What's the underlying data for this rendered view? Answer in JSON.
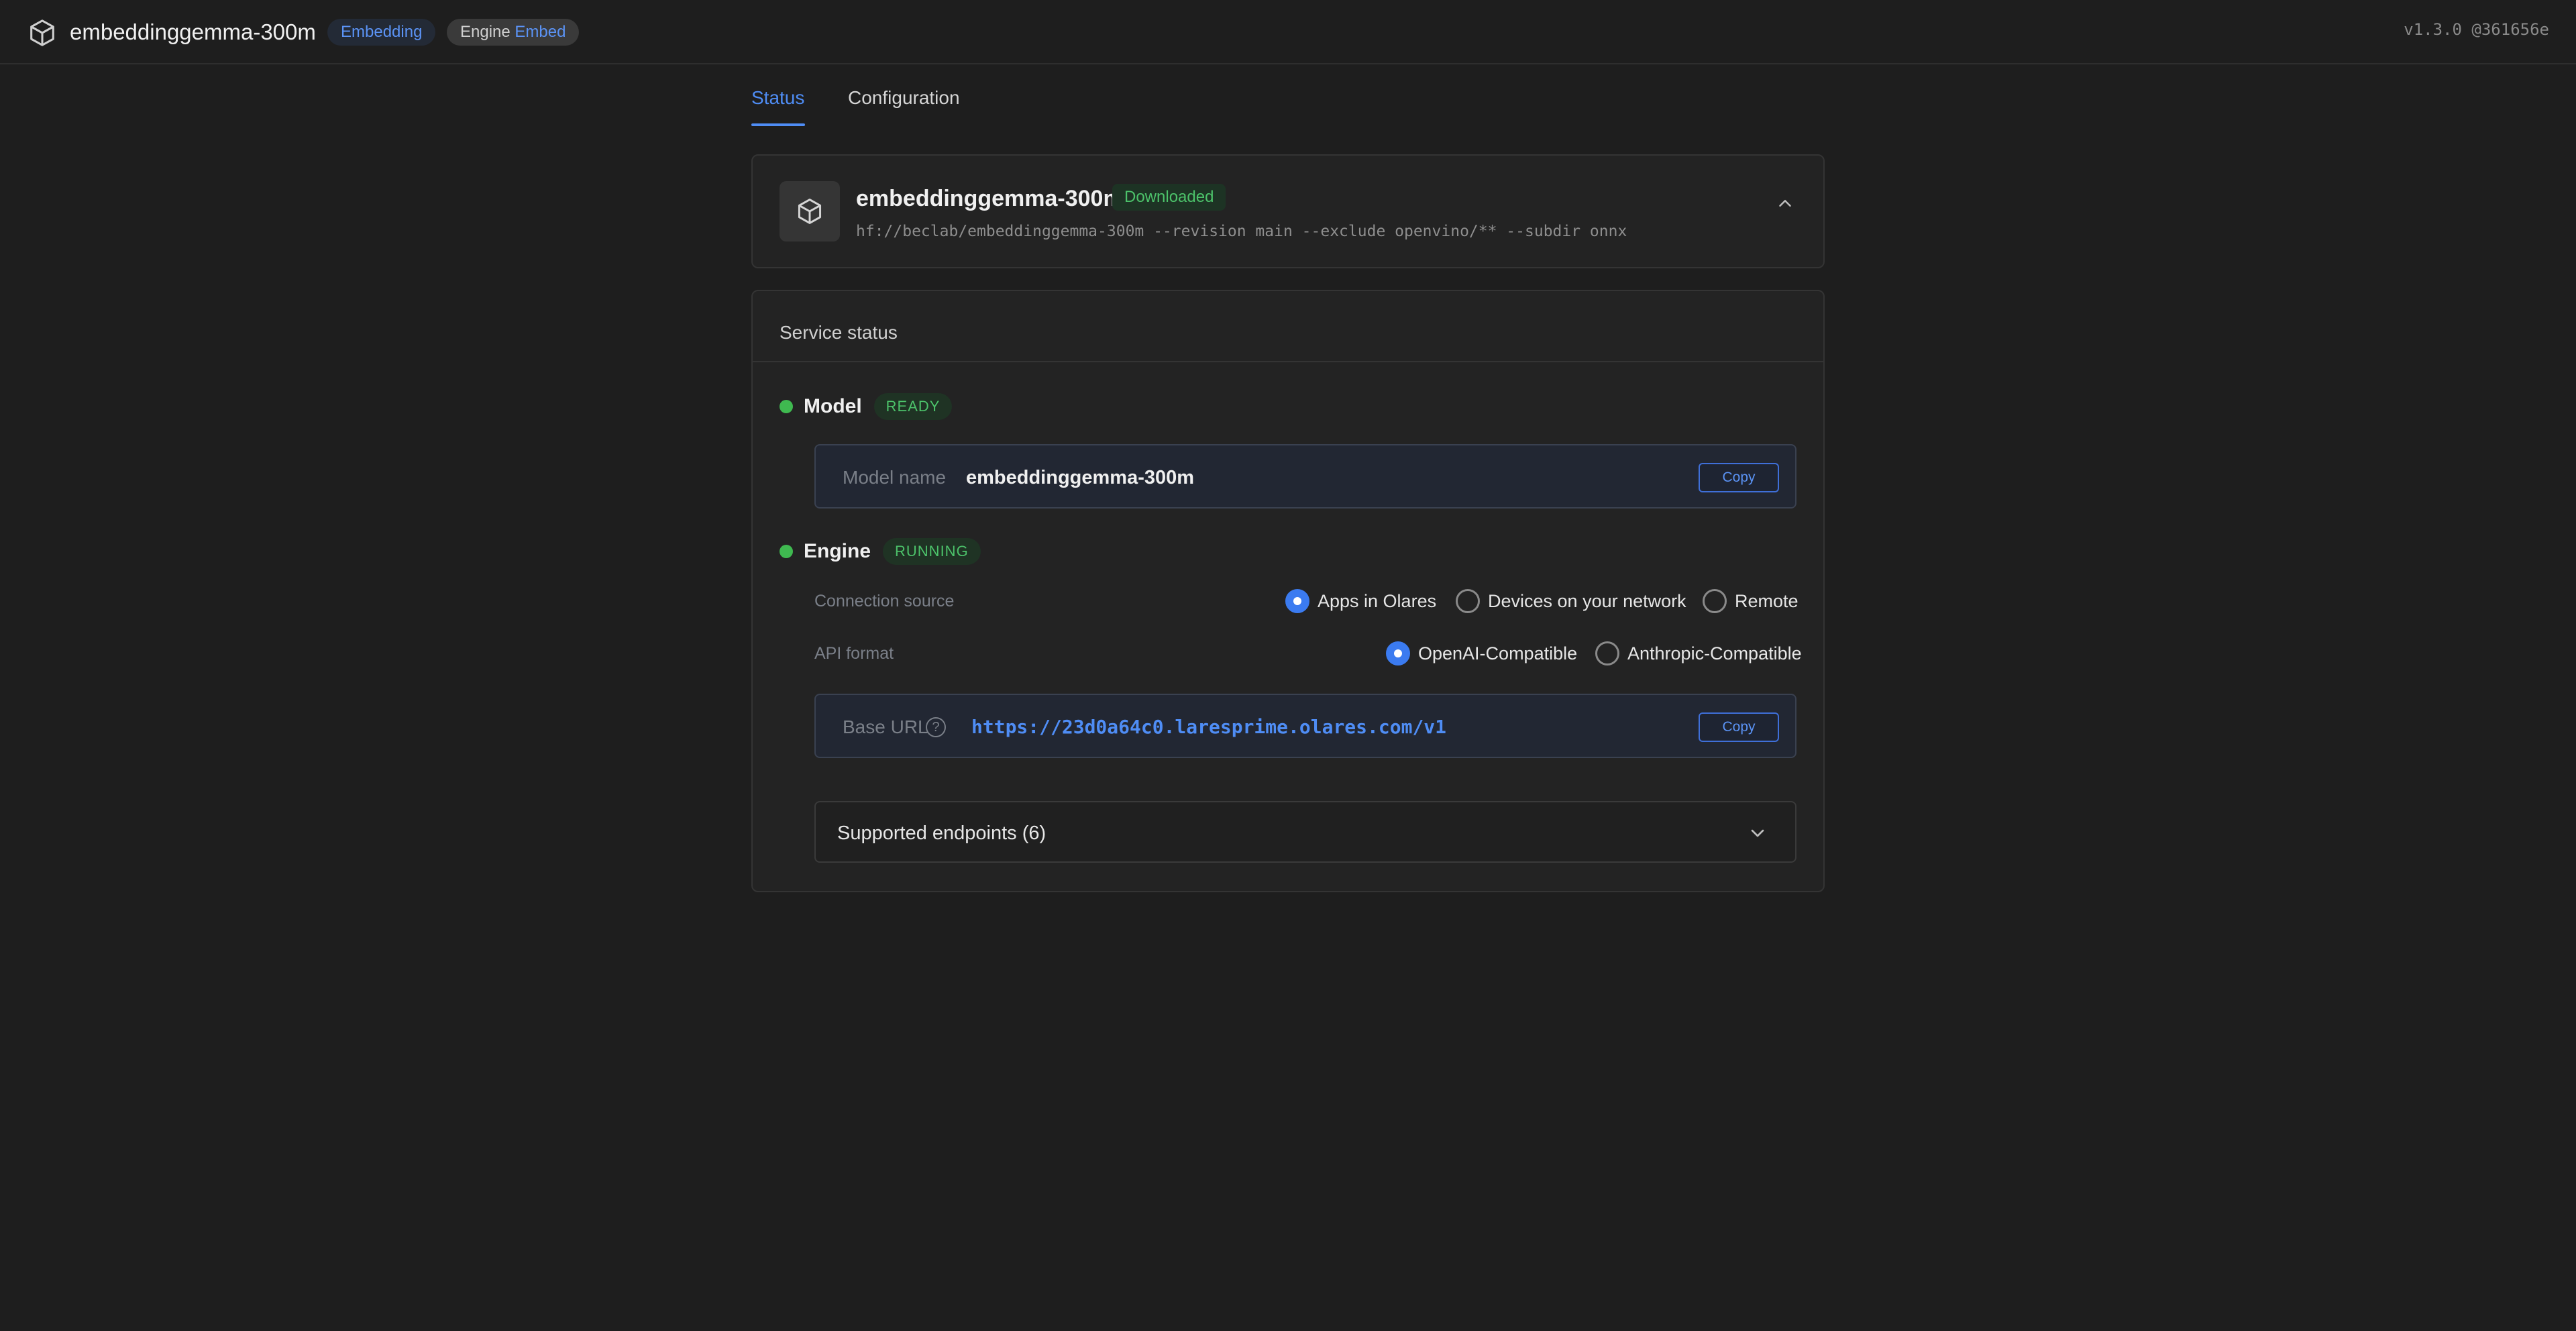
{
  "topbar": {
    "title": "embeddinggemma-300m",
    "tag_embedding": "Embedding",
    "engine_prefix": "Engine",
    "engine_value": "Embed",
    "version": "v1.3.0 @361656e"
  },
  "tabs": [
    {
      "label": "Status",
      "active": true
    },
    {
      "label": "Configuration",
      "active": false
    }
  ],
  "model_card": {
    "name": "embeddinggemma-300m",
    "status": "Downloaded",
    "command": "hf://beclab/embeddinggemma-300m --revision main --exclude openvino/** --subdir onnx"
  },
  "service_status": {
    "title": "Service status",
    "model": {
      "label": "Model",
      "status": "READY",
      "field_label": "Model name",
      "field_value": "embeddinggemma-300m",
      "copy_label": "Copy"
    },
    "engine": {
      "label": "Engine",
      "status": "RUNNING",
      "connection_source_label": "Connection source",
      "connection_options": [
        "Apps in Olares",
        "Devices on your network",
        "Remote"
      ],
      "connection_selected": "Apps in Olares",
      "api_format_label": "API format",
      "api_options": [
        "OpenAI-Compatible",
        "Anthropic-Compatible"
      ],
      "api_selected": "OpenAI-Compatible",
      "base_url_label": "Base URL",
      "help_glyph": "?",
      "base_url": "https://23d0a64c0.laresprime.olares.com/v1",
      "copy_label": "Copy"
    },
    "endpoints_label": "Supported endpoints (6)"
  },
  "colors": {
    "accent": "#4f8df5",
    "ready_green": "#3fb950",
    "background": "#1e1e1e"
  }
}
